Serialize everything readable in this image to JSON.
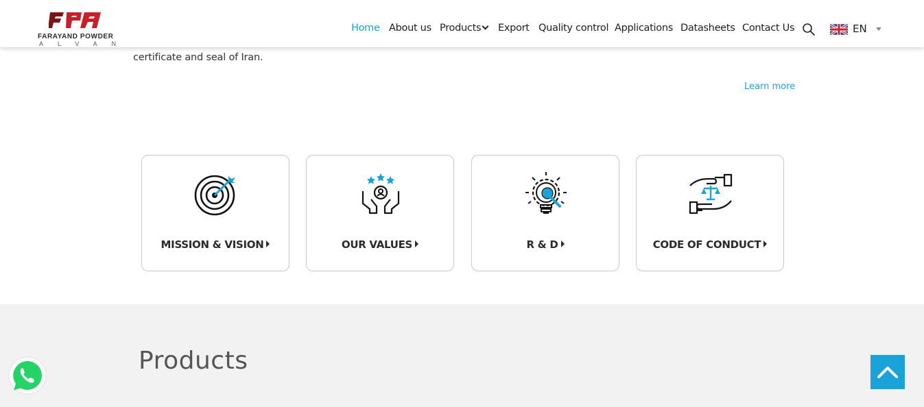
{
  "header": {
    "logo_mark": "FPA",
    "logo_name": "FARAYAND POWDER",
    "logo_sub": "ALVAN",
    "nav": [
      {
        "label": "Home",
        "active": true
      },
      {
        "label": "About us"
      },
      {
        "label": "Products",
        "has_dropdown": true
      },
      {
        "label": "Export"
      },
      {
        "label": "Quality control"
      },
      {
        "label": "Applications"
      },
      {
        "label": "Datasheets"
      },
      {
        "label": "Contact Us"
      }
    ],
    "search_icon": "search-icon",
    "language": {
      "label": "EN",
      "flag": "uk-flag-icon"
    }
  },
  "intro": {
    "text": "certificate and seal of Iran.",
    "learn_more": "Learn more"
  },
  "cards": [
    {
      "label": "MISSION & VISION",
      "icon": "target-icon"
    },
    {
      "label": "OUR VALUES",
      "icon": "values-hands-icon"
    },
    {
      "label": "R & D",
      "icon": "lightbulb-gear-icon"
    },
    {
      "label": "CODE OF CONDUCT",
      "icon": "hand-scales-icon"
    }
  ],
  "products": {
    "title": "Products"
  },
  "colors": {
    "accent": "#1aa3d9",
    "logo_red": "#c8202a",
    "logo_dark": "#7a1418",
    "section_bg": "#f2f2f2"
  },
  "floating": {
    "whatsapp_icon": "whatsapp-icon",
    "scroll_top_icon": "chevron-up-icon"
  }
}
